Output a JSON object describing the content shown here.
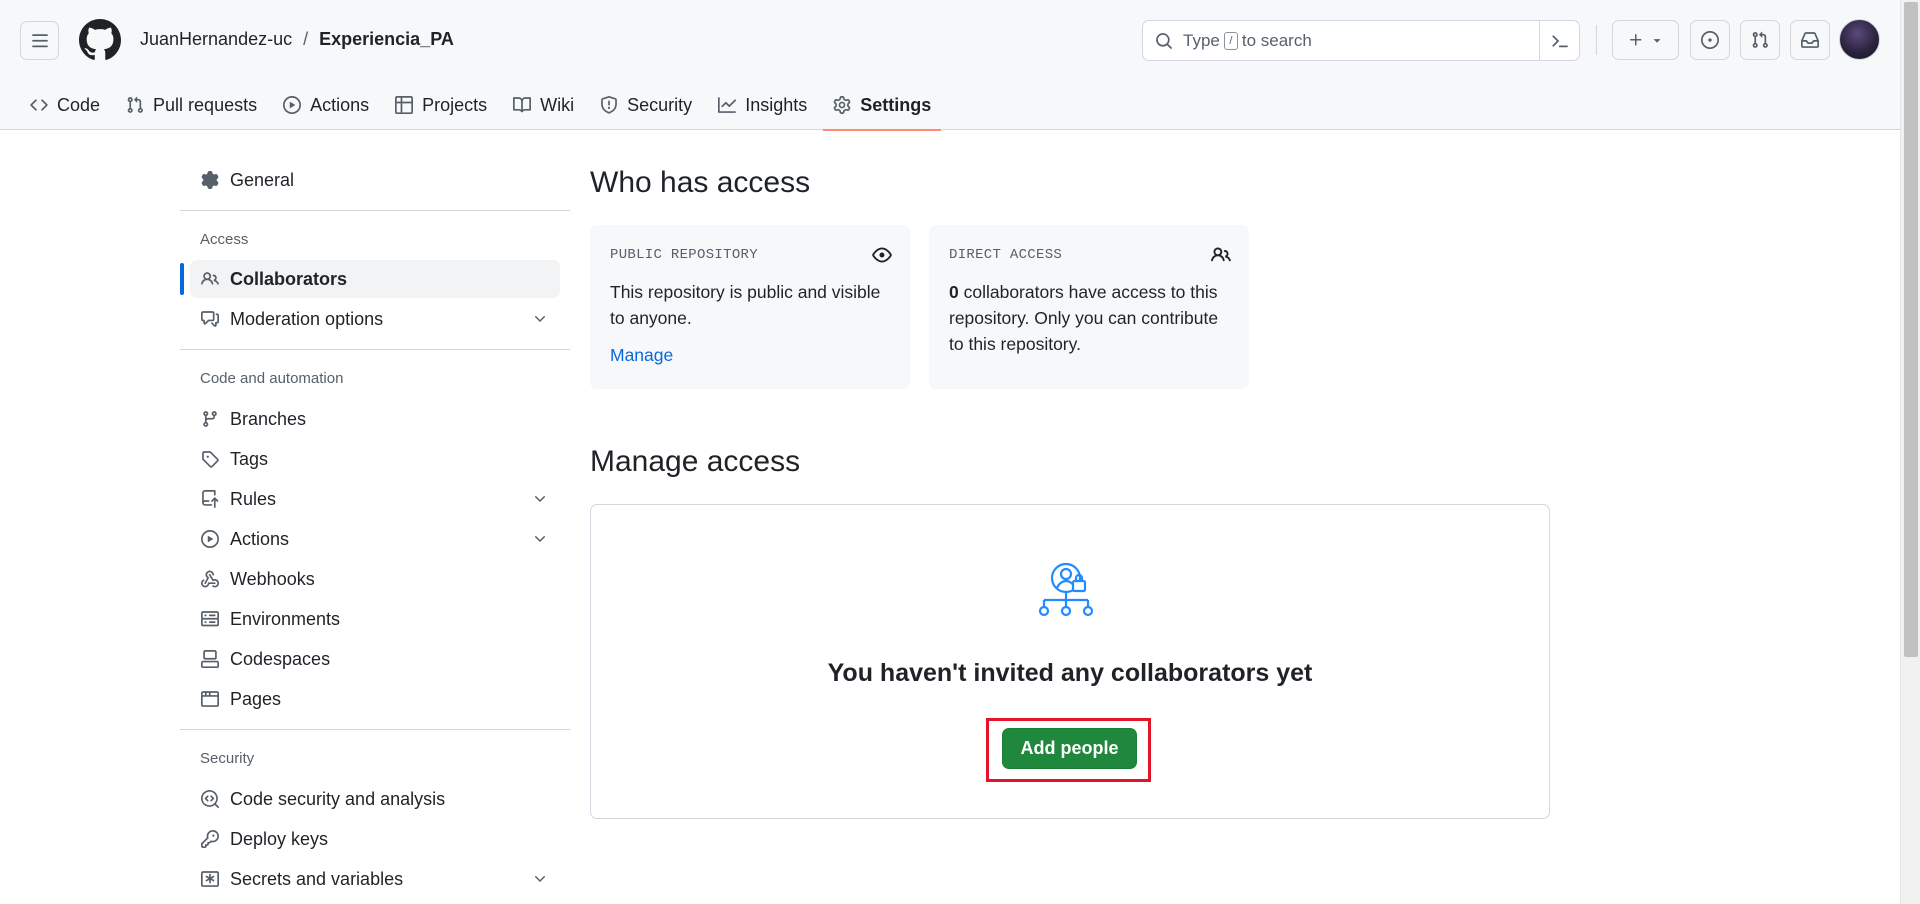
{
  "header": {
    "owner": "JuanHernandez-uc",
    "separator": "/",
    "repo": "Experiencia_PA",
    "search": {
      "prefix": "Type",
      "key": "/",
      "suffix": "to search"
    }
  },
  "repo_nav": {
    "code": "Code",
    "pull_requests": "Pull requests",
    "actions": "Actions",
    "projects": "Projects",
    "wiki": "Wiki",
    "security": "Security",
    "insights": "Insights",
    "settings": "Settings"
  },
  "sidebar": {
    "general": "General",
    "access_heading": "Access",
    "collaborators": "Collaborators",
    "moderation": "Moderation options",
    "code_heading": "Code and automation",
    "branches": "Branches",
    "tags": "Tags",
    "rules": "Rules",
    "actions": "Actions",
    "webhooks": "Webhooks",
    "environments": "Environments",
    "codespaces": "Codespaces",
    "pages": "Pages",
    "security_heading": "Security",
    "code_security": "Code security and analysis",
    "deploy_keys": "Deploy keys",
    "secrets": "Secrets and variables"
  },
  "main": {
    "who_title": "Who has access",
    "public_card": {
      "label": "PUBLIC REPOSITORY",
      "text": "This repository is public and visible to anyone.",
      "link": "Manage"
    },
    "direct_card": {
      "label": "DIRECT ACCESS",
      "count": "0",
      "text": " collaborators have access to this repository. Only you can contribute to this repository."
    },
    "manage_title": "Manage access",
    "empty_title": "You haven't invited any collaborators yet",
    "add_button": "Add people"
  },
  "colors": {
    "accent": "#0969da",
    "primary_button": "#1f883d",
    "tab_underline": "#fd8c73",
    "highlight": "#e3152a"
  }
}
